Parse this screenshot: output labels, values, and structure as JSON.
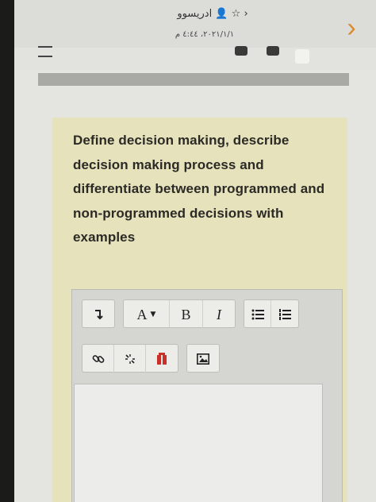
{
  "header": {
    "title": "ادريسوو",
    "timestamp": "٢٠٢١/١/١، ٤:٤٤ م"
  },
  "question": {
    "text": "Define decision making, describe decision making process and differentiate between programmed and non-programmed decisions with examples"
  },
  "toolbar": {
    "font_label": "A",
    "bold_label": "B",
    "italic_label": "I"
  }
}
